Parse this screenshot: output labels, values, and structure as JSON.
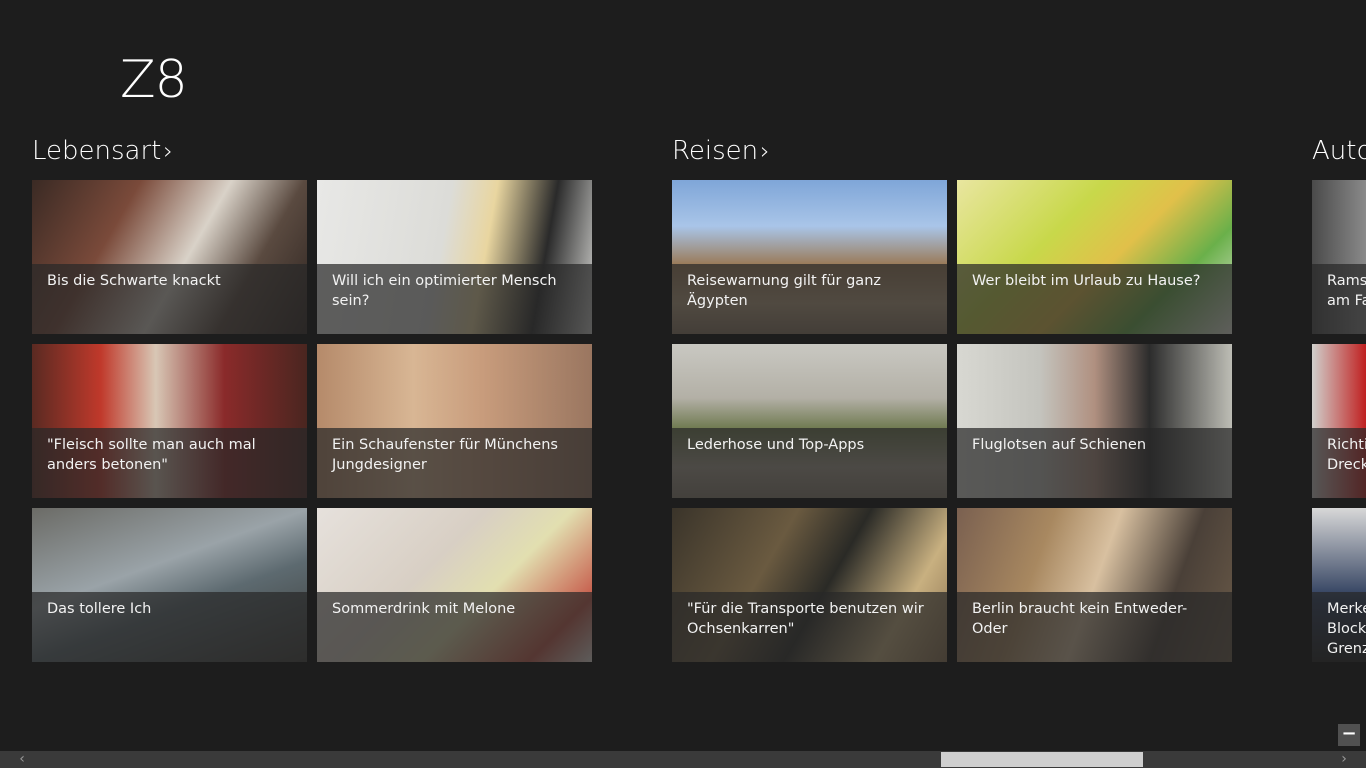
{
  "app": {
    "title": "Z8"
  },
  "sections": {
    "lebensart": {
      "label": "Lebensart",
      "chevron": "›",
      "tiles": [
        "Bis die Schwarte knackt",
        "Will ich ein optimierter Mensch sein?",
        "\"Fleisch sollte man auch mal anders betonen\"",
        "Ein Schaufenster für Münchens Jungdesigner",
        "Das tollere Ich",
        "Sommerdrink mit Melone"
      ]
    },
    "reisen": {
      "label": "Reisen",
      "chevron": "›",
      "tiles": [
        "Reisewarnung gilt für ganz Ägypten",
        "Wer bleibt im Urlaub zu Hause?",
        "Lederhose und Top-Apps",
        "Fluglotsen auf Schienen",
        "\"Für die Transporte benutzen wir Ochsenkarren\"",
        "Berlin braucht kein Entweder-Oder"
      ]
    },
    "auto": {
      "label": "Auto",
      "tiles": [
        "Ramsa am Fa",
        "Richtic Dreck",
        "Merke Blocka Grenz"
      ]
    }
  },
  "controls": {
    "zoom_out_label": "−",
    "scroll_left_icon": "‹",
    "scroll_right_icon": "›"
  },
  "colors": {
    "background": "#1d1d1d",
    "caption_overlay": "rgba(40,40,40,0.72)",
    "scroll_thumb": "#cfcfcf"
  }
}
